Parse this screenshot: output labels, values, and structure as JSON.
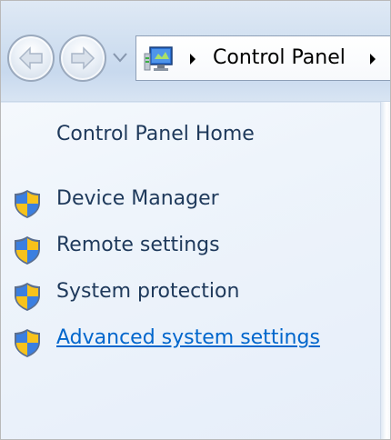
{
  "address_bar": {
    "breadcrumb": "Control Panel"
  },
  "task_pane": {
    "home_link": "Control Panel Home",
    "tasks": [
      {
        "label": "Device Manager",
        "icon": "uac-shield-icon"
      },
      {
        "label": "Remote settings",
        "icon": "uac-shield-icon"
      },
      {
        "label": "System protection",
        "icon": "uac-shield-icon"
      },
      {
        "label": "Advanced system settings",
        "icon": "uac-shield-icon",
        "state": "hover"
      }
    ]
  },
  "colors": {
    "task_text": "#1e395b",
    "link_hover": "#0066cc",
    "pane_background": "#eef4fb"
  }
}
